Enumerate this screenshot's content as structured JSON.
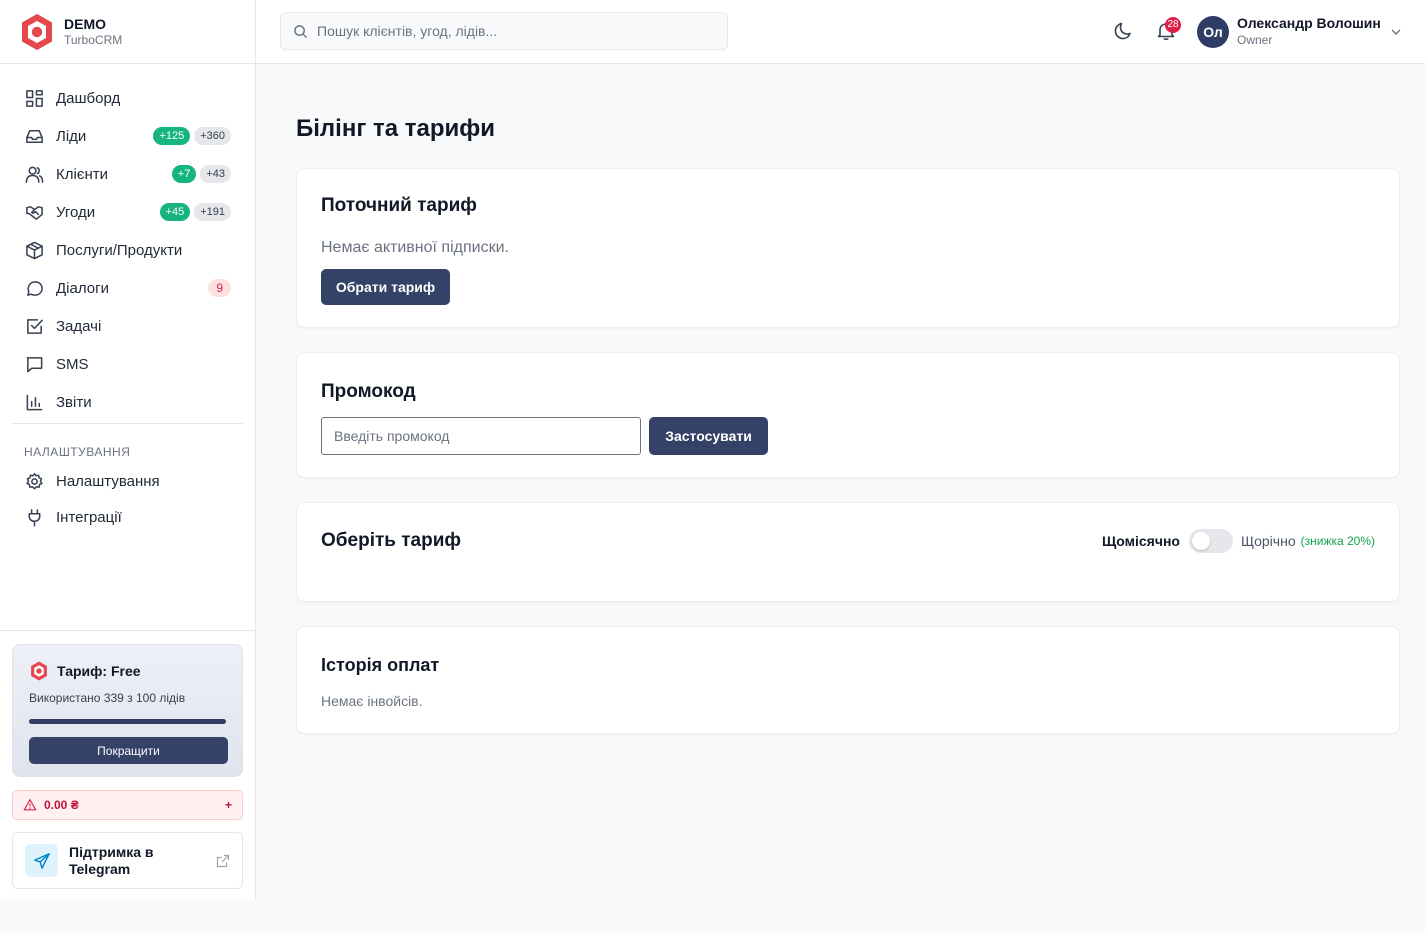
{
  "brand": {
    "name": "DEMO",
    "sub": "TurboCRM"
  },
  "search": {
    "placeholder": "Пошук клієнтів, угод, лідів..."
  },
  "header": {
    "notifications_count": "28",
    "user_initials": "Ол",
    "user_name": "Олександр Волошин",
    "user_role": "Owner"
  },
  "nav": {
    "items": [
      {
        "label": "Дашборд",
        "icon": "dashboard-icon"
      },
      {
        "label": "Ліди",
        "icon": "inbox-icon",
        "badge_new": "+125",
        "badge_total": "+360"
      },
      {
        "label": "Клієнти",
        "icon": "users-icon",
        "badge_new": "+7",
        "badge_total": "+43"
      },
      {
        "label": "Угоди",
        "icon": "handshake-icon",
        "badge_new": "+45",
        "badge_total": "+191"
      },
      {
        "label": "Послуги/Продукти",
        "icon": "box-icon"
      },
      {
        "label": "Діалоги",
        "icon": "chat-icon",
        "badge_count": "9"
      },
      {
        "label": "Задачі",
        "icon": "checkbox-icon"
      },
      {
        "label": "SMS",
        "icon": "message-icon"
      },
      {
        "label": "Звіти",
        "icon": "bar-chart-icon"
      }
    ],
    "settings_section": "НАЛАШТУВАННЯ",
    "settings_items": [
      {
        "label": "Налаштування",
        "icon": "gear-icon"
      },
      {
        "label": "Інтеграції",
        "icon": "plug-icon"
      }
    ]
  },
  "plan": {
    "title": "Тариф: Free",
    "usage": "Використано 339 з 100 лідів",
    "usage_fraction": 1.0,
    "upgrade_label": "Покращити"
  },
  "balance": {
    "amount": "0.00 ₴",
    "plus": "+"
  },
  "support": {
    "label": "Підтримка в Telegram"
  },
  "page": {
    "title": "Білінг та тарифи"
  },
  "current_plan": {
    "title": "Поточний тариф",
    "message": "Немає активної підписки.",
    "button": "Обрати тариф"
  },
  "promo": {
    "title": "Промокод",
    "placeholder": "Введіть промокод",
    "button": "Застосувати"
  },
  "choose_plan": {
    "title": "Оберіть тариф",
    "monthly": "Щомісячно",
    "yearly": "Щорічно",
    "discount": "(знижка 20%)",
    "yearly_enabled": false
  },
  "history": {
    "title": "Історія оплат",
    "message": "Немає інвойсів."
  },
  "colors": {
    "accent": "#344267",
    "green": "#16b57f",
    "red": "#e11d48"
  }
}
